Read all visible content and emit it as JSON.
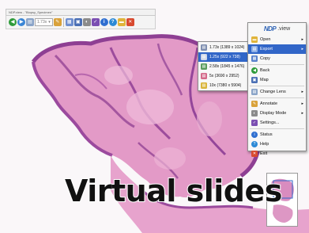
{
  "window": {
    "title": "NDP.view - \"Biopsy_Specimen\""
  },
  "toolbar": {
    "zoom_value": "1.73x"
  },
  "context_menu": {
    "logo": {
      "mark": "NDP",
      "word": ".view"
    },
    "items": [
      {
        "label": "Open",
        "submenu": true
      },
      {
        "label": "Export",
        "submenu": true
      },
      {
        "label": "Copy"
      },
      {
        "label": "Back"
      },
      {
        "label": "Map"
      },
      {
        "label": "Change Lens",
        "submenu": true
      },
      {
        "label": "Annotate",
        "submenu": true
      },
      {
        "label": "Display Mode",
        "submenu": true
      },
      {
        "label": "Settings..."
      },
      {
        "label": "Status"
      },
      {
        "label": "Help"
      },
      {
        "label": "Exit"
      }
    ]
  },
  "export_submenu": {
    "items": [
      {
        "label": "1.73x (1389 x 1024)"
      },
      {
        "label": "1.25x (922 x 738)"
      },
      {
        "label": "2.58x (1845 x 1476)"
      },
      {
        "label": "5x (3690 x 2952)"
      },
      {
        "label": "10x (7380 x 5904)"
      }
    ]
  },
  "caption": "Virtual slides",
  "colors": {
    "menu_highlight": "#3166c8",
    "tissue_pink": "#d97bb7",
    "tissue_purple": "#9a4a9c",
    "logo_blue": "#2d62b5"
  }
}
